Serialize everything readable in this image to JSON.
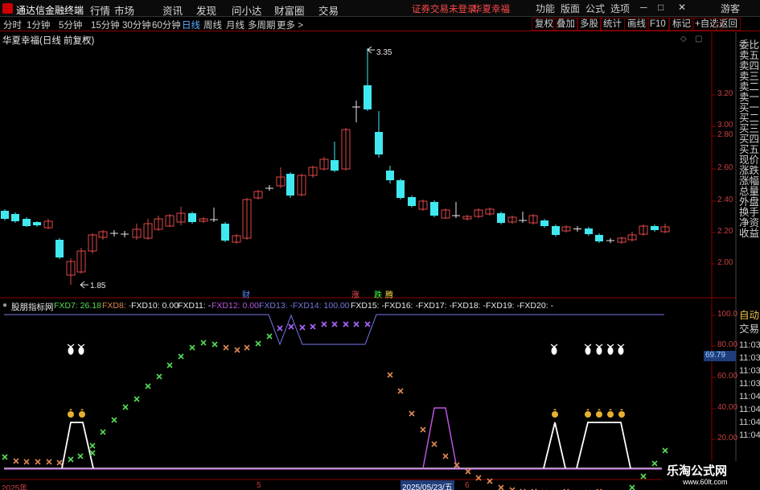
{
  "app": {
    "title": "通达信金融终端"
  },
  "menu": [
    "行情",
    "市场",
    "资讯",
    "发现",
    "问小达",
    "财富圈",
    "交易"
  ],
  "login": {
    "status": "证券交易未登录",
    "stock": "华夏幸福"
  },
  "window_buttons": [
    "功能",
    "版面",
    "公式",
    "选项"
  ],
  "window_controls": {
    "min": "─",
    "max": "□",
    "close": "✕"
  },
  "guest": "游客",
  "periods": [
    "分时",
    "1分钟",
    "5分钟",
    "15分钟",
    "30分钟",
    "60分钟",
    "日线",
    "周线",
    "月线",
    "多周期",
    "更多 >"
  ],
  "active_period": "日线",
  "toolbar": [
    "复权",
    "叠加",
    "多股",
    "统计",
    "画线",
    "F10",
    "标记",
    "+自选",
    "返回"
  ],
  "price_panel": {
    "title": "华夏幸福(日线 前复权)",
    "high_label": "3.35",
    "low_label": "1.85",
    "yticks": [
      "3.20",
      "3.00",
      "2.80",
      "2.60",
      "2.40",
      "2.20",
      "2.00"
    ]
  },
  "event_markers": {
    "cai": "财",
    "zhang": "涨",
    "die": "跌",
    "teng": "腾"
  },
  "indicator": {
    "name": "股朋指标网",
    "items": [
      {
        "label": "FXD7: 26.18",
        "color": "#55dd55"
      },
      {
        "label": "FXD8: -",
        "color": "#dd8855"
      },
      {
        "label": "FXD10: 0.00",
        "color": "#e8e8e8"
      },
      {
        "label": "FXD11: -",
        "color": "#e8e8e8"
      },
      {
        "label": "FXD12: 0.00",
        "color": "#bb55dd"
      },
      {
        "label": "FXD13: -",
        "color": "#7777dd"
      },
      {
        "label": "FXD14: 100.00",
        "color": "#7777dd"
      },
      {
        "label": "FXD15: -",
        "color": "#e8e8e8"
      },
      {
        "label": "FXD16: -",
        "color": "#e8e8e8"
      },
      {
        "label": "FXD17: -",
        "color": "#e8e8e8"
      },
      {
        "label": "FXD18: -",
        "color": "#e8e8e8"
      },
      {
        "label": "FXD19: -",
        "color": "#e8e8e8"
      },
      {
        "label": "FXD20: -",
        "color": "#e8e8e8"
      }
    ],
    "yticks": [
      "100.0",
      "80.00",
      "60.00",
      "40.00",
      "20.00"
    ],
    "current_value": "69.79"
  },
  "date_axis": {
    "year": "2025年",
    "month5": "5",
    "cursor_date": "2025/05/23/五",
    "month6": "6"
  },
  "side_panel": {
    "book": [
      "委比",
      "卖五",
      "卖四",
      "卖三",
      "卖二",
      "卖一",
      "买一",
      "买二",
      "买三",
      "买四",
      "买五",
      "现价",
      "涨跌",
      "涨幅",
      "总量",
      "外盘",
      "换手",
      "净资",
      "收益"
    ],
    "tabs": [
      "自动",
      "交易"
    ],
    "times": [
      "11:03",
      "11:03",
      "11:03",
      "11:03",
      "11:04",
      "11:04",
      "11:04",
      "11:04"
    ]
  },
  "watermark": {
    "title": "乐淘公式网",
    "url": "www.60lt.com"
  },
  "colors": {
    "up": "#e04848",
    "down": "#40e8f0",
    "menu_bg": "#0b0b0b",
    "accent": "#5aaeff",
    "border": "#8b0000"
  }
}
